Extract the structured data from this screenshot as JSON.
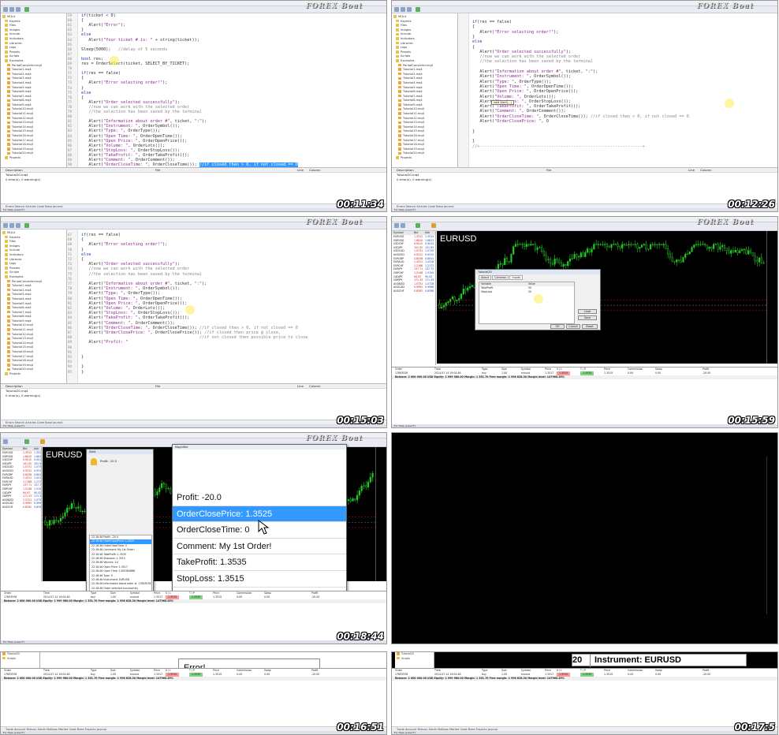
{
  "branding": {
    "logo": "FOREX Boat"
  },
  "timestamps": [
    "00:11:34",
    "00:12:26",
    "00:15:03",
    "00:15:59",
    "00:18:44",
    "00:16:51",
    "00:17:5"
  ],
  "editor": {
    "nav_items": [
      {
        "label": "MQL4",
        "type": "folder"
      },
      {
        "label": "Experts",
        "type": "folder"
      },
      {
        "label": "Files",
        "type": "folder"
      },
      {
        "label": "Images",
        "type": "folder"
      },
      {
        "label": "Include",
        "type": "folder"
      },
      {
        "label": "Indicators",
        "type": "folder"
      },
      {
        "label": "Libraries",
        "type": "folder"
      },
      {
        "label": "Logs",
        "type": "folder"
      },
      {
        "label": "Presets",
        "type": "folder"
      },
      {
        "label": "Scripts",
        "type": "folder"
      },
      {
        "label": "Examples",
        "type": "folder"
      },
      {
        "label": "PeriodConverter.mq4",
        "type": "file"
      },
      {
        "label": "Tutorial1.mq4",
        "type": "file"
      },
      {
        "label": "Tutorial2.mq4",
        "type": "file"
      },
      {
        "label": "Tutorial3.mq4",
        "type": "file"
      },
      {
        "label": "Tutorial4.mq4",
        "type": "file"
      },
      {
        "label": "Tutorial5.mq4",
        "type": "file"
      },
      {
        "label": "Tutorial6.mq4",
        "type": "file"
      },
      {
        "label": "Tutorial7.mq4",
        "type": "file"
      },
      {
        "label": "Tutorial8.mq4",
        "type": "file"
      },
      {
        "label": "Tutorial9.mq4",
        "type": "file"
      },
      {
        "label": "Tutorial10.mq4",
        "type": "file"
      },
      {
        "label": "Tutorial11.mq4",
        "type": "file"
      },
      {
        "label": "Tutorial12.mq4",
        "type": "file"
      },
      {
        "label": "Tutorial13.mq4",
        "type": "file"
      },
      {
        "label": "Tutorial14.mq4",
        "type": "file"
      },
      {
        "label": "Tutorial15.mq4",
        "type": "file"
      },
      {
        "label": "Tutorial16.mq4",
        "type": "file"
      },
      {
        "label": "Tutorial17.mq4",
        "type": "file"
      },
      {
        "label": "Tutorial18.mq4",
        "type": "file"
      },
      {
        "label": "Tutorial19.mq4",
        "type": "file"
      },
      {
        "label": "Tutorial20.mq4",
        "type": "file"
      },
      {
        "label": "Projects",
        "type": "folder"
      }
    ],
    "toolbox": {
      "headers": [
        "Description",
        "File",
        "Line",
        "Column"
      ],
      "rows": [
        "Tutorial20.mq4",
        "0 error(s), 0 warning(s)"
      ]
    },
    "tabs": [
      "Errors",
      "Search",
      "Articles",
      "Code Base",
      "Journal"
    ],
    "status": "For Help, press F1",
    "code_1": [
      {
        "n": "59",
        "t": "if(ticket < 0)"
      },
      {
        "n": "60",
        "t": "{"
      },
      {
        "n": "61",
        "t": "   Alert(\"Error\");"
      },
      {
        "n": "62",
        "t": "}"
      },
      {
        "n": "63",
        "t": "else"
      },
      {
        "n": "64",
        "t": "   Alert(\"Your ticket # is: \" + string(ticket));"
      },
      {
        "n": "65",
        "t": ""
      },
      {
        "n": "66",
        "t": "Sleep(5000);   //delay of 5 seconds"
      },
      {
        "n": "67",
        "t": ""
      },
      {
        "n": "68",
        "t": "bool res;"
      },
      {
        "n": "69",
        "t": "res = OrderSelect(ticket, SELECT_BY_TICKET);"
      },
      {
        "n": "70",
        "t": ""
      },
      {
        "n": "71",
        "t": "if(res == false)"
      },
      {
        "n": "72",
        "t": "{"
      },
      {
        "n": "73",
        "t": "   Alert(\"Error selecting order!\");"
      },
      {
        "n": "74",
        "t": "}"
      },
      {
        "n": "75",
        "t": "else"
      },
      {
        "n": "76",
        "t": "{"
      },
      {
        "n": "77",
        "t": "   Alert(\"Order selected successfully\");"
      },
      {
        "n": "78",
        "t": "   //now we can work with the selected order"
      },
      {
        "n": "79",
        "t": "   //the selection has been saved by the terminal"
      },
      {
        "n": "80",
        "t": ""
      },
      {
        "n": "81",
        "t": "   Alert(\"Information about order #\", ticket, \":\");"
      },
      {
        "n": "82",
        "t": "   Alert(\"Instrument: \", OrderSymbol());"
      },
      {
        "n": "83",
        "t": "   Alert(\"Type: \", OrderType());"
      },
      {
        "n": "84",
        "t": "   Alert(\"Open Time: \", OrderOpenTime());"
      },
      {
        "n": "85",
        "t": "   Alert(\"Open Price: \", OrderOpenPrice());"
      },
      {
        "n": "86",
        "t": "   Alert(\"Volume: \", OrderLots());"
      },
      {
        "n": "87",
        "t": "   Alert(\"StopLoss: \", OrderStopLoss());"
      },
      {
        "n": "88",
        "t": "   Alert(\"TakeProfit: \", OrderTakeProfit());"
      },
      {
        "n": "89",
        "t": "   Alert(\"Comment: \", OrderComment());"
      },
      {
        "n": "90",
        "t": "   Alert(\"OrderCloseTime: \", OrderCloseTime()); //if closed then > 0, if not closed == 0"
      }
    ],
    "code_2": [
      {
        "n": "",
        "t": "if(res == false)"
      },
      {
        "n": "",
        "t": "{"
      },
      {
        "n": "",
        "t": "   Alert(\"Error selecting order!\");"
      },
      {
        "n": "",
        "t": "}"
      },
      {
        "n": "",
        "t": "else"
      },
      {
        "n": "",
        "t": "{"
      },
      {
        "n": "",
        "t": "   Alert(\"Order selected successfully\");"
      },
      {
        "n": "",
        "t": "   //now we can work with the selected order"
      },
      {
        "n": "",
        "t": "   //the selection has been saved by the terminal"
      },
      {
        "n": "",
        "t": ""
      },
      {
        "n": "",
        "t": "   Alert(\"Information about order #\", ticket, \":\");"
      },
      {
        "n": "",
        "t": "   Alert(\"Instrument: \", OrderSymbol());"
      },
      {
        "n": "",
        "t": "   Alert(\"Type: \", OrderType());"
      },
      {
        "n": "",
        "t": "   Alert(\"Open Time: \", OrderOpenTime());"
      },
      {
        "n": "",
        "t": "   Alert(\"Open Price: \", OrderOpenPrice());"
      },
      {
        "n": "",
        "t": "   Alert(\"Volume: \", OrderLots());"
      },
      {
        "n": "",
        "t": "   Alert(\"StopLoss: \", OrderStopLoss());"
      },
      {
        "n": "",
        "t": "   Alert(\"TakeProfit: \", OrderTakeProfit());"
      },
      {
        "n": "",
        "t": "   Alert(\"Comment: \", OrderComment());"
      },
      {
        "n": "",
        "t": "   Alert(\"OrderCloseTime: \", OrderCloseTime()); //if closed then > 0, if not closed == 0"
      },
      {
        "n": "",
        "t": "   Alert(\"OrderClosePrice: \", O"
      },
      {
        "n": "",
        "t": ""
      },
      {
        "n": "",
        "t": "}"
      },
      {
        "n": "",
        "t": ""
      },
      {
        "n": "",
        "t": "}"
      },
      {
        "n": "",
        "t": "//+------------------------------------------------------------------+"
      }
    ],
    "code_3": [
      {
        "n": "67",
        "t": "if(res == false)"
      },
      {
        "n": "68",
        "t": "{"
      },
      {
        "n": "69",
        "t": "   Alert(\"Error selecting order!\");"
      },
      {
        "n": "70",
        "t": "}"
      },
      {
        "n": "71",
        "t": "else"
      },
      {
        "n": "72",
        "t": "{"
      },
      {
        "n": "73",
        "t": "   Alert(\"Order selected successfully\");"
      },
      {
        "n": "74",
        "t": "   //now we can work with the selected order"
      },
      {
        "n": "75",
        "t": "   //the selection has been saved by the terminal"
      },
      {
        "n": "76",
        "t": ""
      },
      {
        "n": "77",
        "t": "   Alert(\"Information about order #\", ticket, \":\");"
      },
      {
        "n": "78",
        "t": "   Alert(\"Instrument: \", OrderSymbol());"
      },
      {
        "n": "79",
        "t": "   Alert(\"Type: \", OrderType());"
      },
      {
        "n": "80",
        "t": "   Alert(\"Open Time: \", OrderOpenTime());"
      },
      {
        "n": "81",
        "t": "   Alert(\"Open Price: \", OrderOpenPrice());"
      },
      {
        "n": "82",
        "t": "   Alert(\"Volume: \", OrderLots());"
      },
      {
        "n": "83",
        "t": "   Alert(\"StopLoss: \", OrderStopLoss());"
      },
      {
        "n": "84",
        "t": "   Alert(\"TakeProfit: \", OrderTakeProfit());"
      },
      {
        "n": "85",
        "t": "   Alert(\"Comment: \", OrderComment());"
      },
      {
        "n": "86",
        "t": "   Alert(\"OrderCloseTime: \", OrderCloseTime()); //if closed then > 0, if not closed == 0"
      },
      {
        "n": "87",
        "t": "   Alert(\"OrderClosePrice: \", OrderClosePrice()); //if closed then price @ close,"
      },
      {
        "n": "88",
        "t": "                                                //if not closed then possible price to close"
      },
      {
        "n": "89",
        "t": "   Alert(\"Profit: \""
      },
      {
        "n": "90",
        "t": ""
      },
      {
        "n": "91",
        "t": ""
      },
      {
        "n": "92",
        "t": "}"
      },
      {
        "n": "93",
        "t": ""
      },
      {
        "n": "94",
        "t": "}"
      },
      {
        "n": "95",
        "t": "}"
      }
    ]
  },
  "terminal": {
    "symbol": "EURUSD",
    "market_watch_header": [
      "Symbol",
      "Bid",
      "Ask"
    ],
    "market_watch": [
      {
        "s": "EURUSD",
        "b": "1.3512",
        "a": "1.3514"
      },
      {
        "s": "GBPUSD",
        "b": "1.6810",
        "a": "1.6813"
      },
      {
        "s": "USDCHF",
        "b": "0.9012",
        "a": "0.9015"
      },
      {
        "s": "USDJPY",
        "b": "101.92",
        "a": "101.95"
      },
      {
        "s": "USDCAD",
        "b": "1.0731",
        "a": "1.0734"
      },
      {
        "s": "AUDUSD",
        "b": "0.9312",
        "a": "0.9315"
      },
      {
        "s": "EURGBP",
        "b": "0.8038",
        "a": "0.8041"
      },
      {
        "s": "EURAUD",
        "b": "1.4511",
        "a": "1.4516"
      },
      {
        "s": "EURCHF",
        "b": "1.2168",
        "a": "1.2172"
      },
      {
        "s": "EURJPY",
        "b": "137.71",
        "a": "137.75"
      },
      {
        "s": "GBPCHF",
        "b": "1.5148",
        "a": "1.5154"
      },
      {
        "s": "CADJPY",
        "b": "94.97",
        "a": "95.02"
      },
      {
        "s": "GBPJPY",
        "b": "171.33",
        "a": "171.39"
      },
      {
        "s": "AUDNZD",
        "b": "1.0721",
        "a": "1.0728"
      },
      {
        "s": "AUDCAD",
        "b": "0.9992",
        "a": "0.9998"
      },
      {
        "s": "AUDCHF",
        "b": "0.8392",
        "a": "0.8398"
      }
    ],
    "trade_header": [
      "Order",
      "Time",
      "Type",
      "Size",
      "Symbol",
      "Price",
      "S / L",
      "T / P",
      "Price",
      "Commission",
      "Swap",
      "Profit"
    ],
    "trade_row": [
      "17893536",
      "2014.07.14 19:04:46",
      "buy",
      "1.00",
      "eurusd",
      "1.3517",
      "1.3515",
      "1.3535",
      "1.3515",
      "0.00",
      "0.00",
      "-20.00"
    ],
    "balance_row": "Balance: 2 000 000.00 USD  Equity: 1 999 980.00  Margin: 1 351.70  Free margin: 1 998 628.30  Margin level: 147960.49%",
    "tabs": [
      "Trade",
      "Account History",
      "Alerts",
      "Mailbox",
      "Market",
      "Code Base",
      "Experts",
      "Journal"
    ],
    "status": "For Help, press F1",
    "default_label": "Default"
  },
  "inputs_dialog": {
    "title": "Tutorial20",
    "tabs": [
      "About",
      "Common",
      "Inputs"
    ],
    "header": [
      "Variable",
      "Value"
    ],
    "rows": [
      {
        "var": "TakeProfit",
        "val": "50"
      },
      {
        "var": "StopLoss",
        "val": "50"
      }
    ],
    "buttons": [
      "Load",
      "Save",
      "OK",
      "Cancel",
      "Reset"
    ]
  },
  "alert_dialog": {
    "title": "Alert",
    "header": "Profit: -20.0",
    "rows": [
      "22:16:46  Profit: -20.0",
      "22:16:46  OrderClosePrice: 1.3525",
      "22:16:46  OrderCloseTime: 0",
      "22:16:46  Comment: My 1st Order!",
      "22:16:46  TakeProfit: 1.3535",
      "22:16:46  StopLoss: 1.3515",
      "22:16:46  Volume: 1.0",
      "22:16:46  Open Price: 1.3517",
      "22:16:46  Open Time: 1405364686",
      "22:16:46  Type: 0",
      "22:16:46  Instrument: EURUSD",
      "22:16:46  Information about order #: 17893536",
      "22:16:46  Order selected successfully",
      "22:16:41  Your ticket # is: 17893536",
      "22:16:41  Error"
    ],
    "zoom_title": "Magnifier",
    "zoom_rows": [
      "Profit: -20.0",
      "OrderClosePrice: 1.3525",
      "OrderCloseTime: 0",
      "Comment: My 1st Order!",
      "TakeProfit: 1.3535",
      "StopLoss: 1.3515"
    ],
    "zoom_active_index": 1
  },
  "strip_1": {
    "big_text": "Error!"
  },
  "strip_2": {
    "big_text": "Instrument: EURUSD",
    "prefix": "20"
  },
  "colors": {
    "accent": "#3399ff",
    "chart_bg": "#000000",
    "candle": "#22cc22",
    "sl": "#ff9a9a",
    "tp": "#7fd67f"
  }
}
